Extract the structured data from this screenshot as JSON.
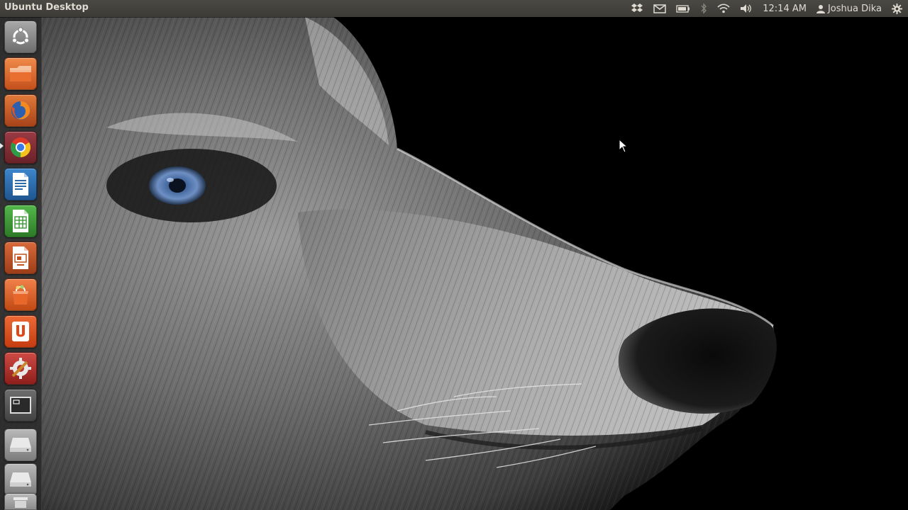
{
  "panel": {
    "title": "Ubuntu Desktop",
    "clock": "12:14 AM",
    "user": "Joshua Dika"
  },
  "launcher": {
    "items": [
      {
        "name": "dash-home",
        "icon": "ubuntu-logo-icon",
        "color": "#8a8a8a"
      },
      {
        "name": "files",
        "icon": "folder-icon",
        "color": "#e8682b"
      },
      {
        "name": "firefox",
        "icon": "firefox-icon",
        "color": "#c8571f"
      },
      {
        "name": "chrome",
        "icon": "chrome-icon",
        "color": "#7a2e36"
      },
      {
        "name": "libreoffice-writer",
        "icon": "writer-icon",
        "color": "#2e6aa8"
      },
      {
        "name": "libreoffice-calc",
        "icon": "calc-icon",
        "color": "#3a9a35"
      },
      {
        "name": "libreoffice-impress",
        "icon": "impress-icon",
        "color": "#c1531f"
      },
      {
        "name": "software-center",
        "icon": "shopping-bag-icon",
        "color": "#e0601d"
      },
      {
        "name": "ubuntu-one",
        "icon": "ubuntu-one-icon",
        "color": "#dd4814"
      },
      {
        "name": "system-settings",
        "icon": "settings-tools-icon",
        "color": "#b7322e"
      },
      {
        "name": "workspace-switcher",
        "icon": "workspace-icon",
        "color": "#6a6a6a"
      },
      {
        "name": "drive-1",
        "icon": "drive-icon",
        "color": "#8c8c8c"
      },
      {
        "name": "drive-2",
        "icon": "drive-icon",
        "color": "#8c8c8c"
      },
      {
        "name": "trash",
        "icon": "trash-icon",
        "color": "#8c8c8c"
      }
    ]
  },
  "indicators": [
    {
      "name": "dropbox",
      "icon": "dropbox-icon"
    },
    {
      "name": "messaging",
      "icon": "envelope-icon"
    },
    {
      "name": "battery",
      "icon": "battery-icon"
    },
    {
      "name": "bluetooth",
      "icon": "bluetooth-icon"
    },
    {
      "name": "network",
      "icon": "wifi-icon"
    },
    {
      "name": "sound",
      "icon": "speaker-icon"
    },
    {
      "name": "session",
      "icon": "gear-icon"
    }
  ]
}
